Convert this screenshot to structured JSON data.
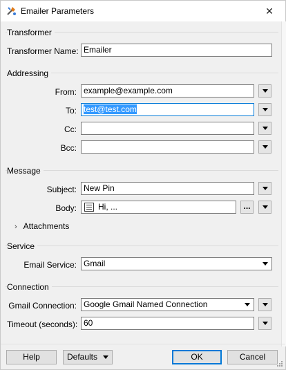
{
  "window": {
    "title": "Emailer Parameters",
    "close_glyph": "✕"
  },
  "transformer": {
    "group_title": "Transformer",
    "name_label": "Transformer Name:",
    "name_value": "Emailer"
  },
  "addressing": {
    "group_title": "Addressing",
    "from_label": "From:",
    "from_value": "example@example.com",
    "to_label": "To:",
    "to_value": "test@test.com",
    "cc_label": "Cc:",
    "cc_value": "",
    "bcc_label": "Bcc:",
    "bcc_value": ""
  },
  "message": {
    "group_title": "Message",
    "subject_label": "Subject:",
    "subject_value": "New Pin",
    "body_label": "Body:",
    "body_value": "Hi, ...",
    "ellipsis_label": "...",
    "attachments_label": "Attachments"
  },
  "service": {
    "group_title": "Service",
    "email_service_label": "Email Service:",
    "email_service_value": "Gmail"
  },
  "connection": {
    "group_title": "Connection",
    "gmail_connection_label": "Gmail Connection:",
    "gmail_connection_value": "Google Gmail Named Connection",
    "timeout_label": "Timeout (seconds):",
    "timeout_value": "60"
  },
  "footer": {
    "help_label": "Help",
    "defaults_label": "Defaults",
    "ok_label": "OK",
    "cancel_label": "Cancel"
  }
}
